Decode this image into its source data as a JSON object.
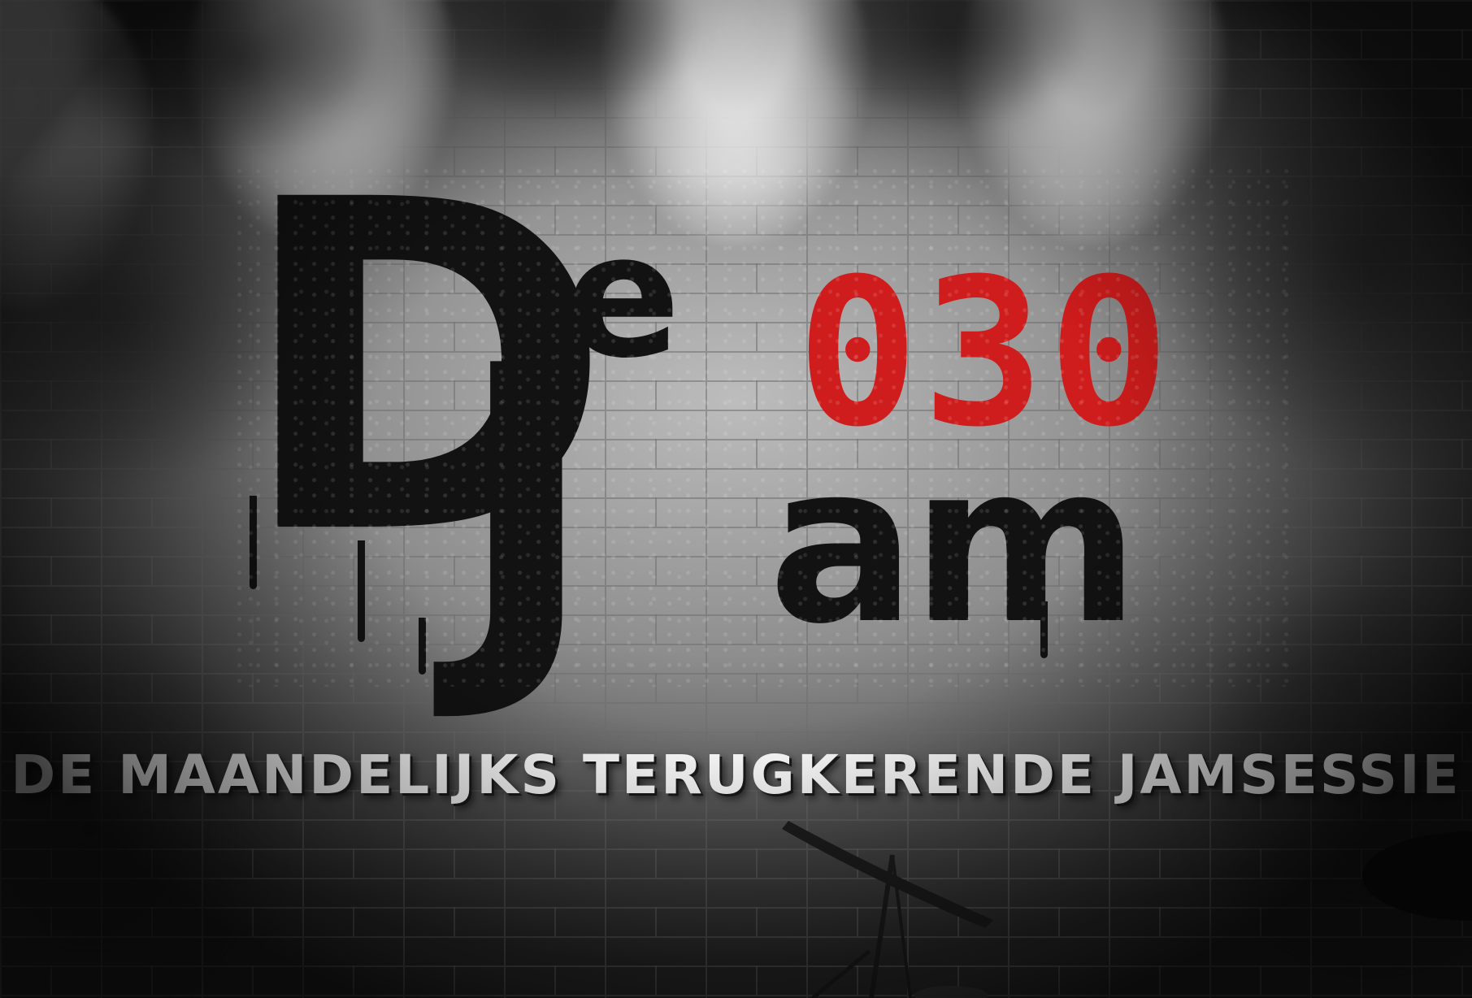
{
  "logo": {
    "letter_d": "D",
    "letter_e": "e",
    "letter_j": "J",
    "letters_am": "am",
    "number": "030"
  },
  "tagline": "DE MAANDELIJKS TERUGKERENDE JAMSESSIE",
  "colors": {
    "logo_black": "#121212",
    "accent_red": "#cf1c1c",
    "tagline_white": "#ffffff"
  }
}
